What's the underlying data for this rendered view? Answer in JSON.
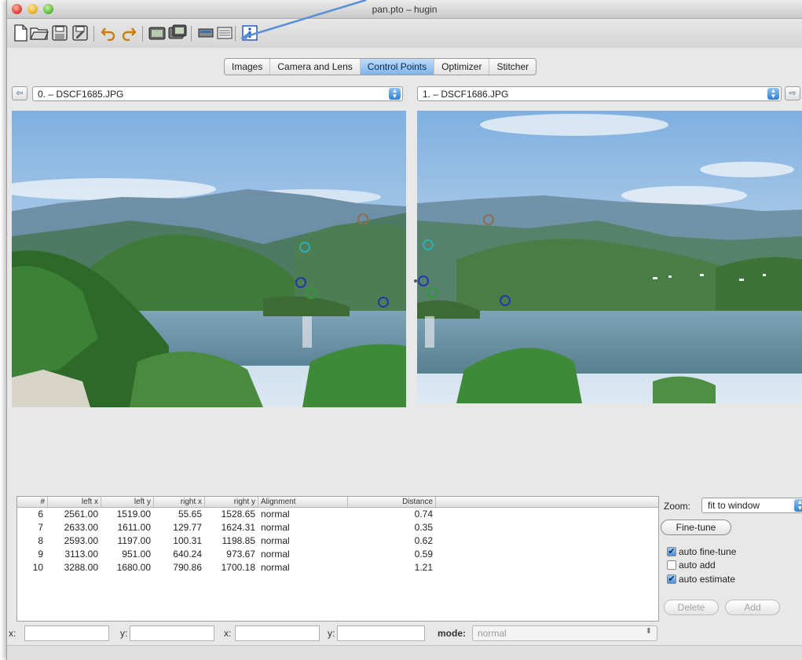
{
  "window": {
    "title": "pan.pto – hugin"
  },
  "toolbar": {
    "icons": [
      "new-file-icon",
      "open-folder-icon",
      "save-icon",
      "save-as-icon",
      "undo-icon",
      "redo-icon",
      "assistant-icon",
      "batch-icon",
      "preview-icon",
      "fast-preview-icon",
      "info-icon"
    ]
  },
  "tabs": [
    {
      "label": "Images"
    },
    {
      "label": "Camera and Lens"
    },
    {
      "label": "Control Points",
      "active": true
    },
    {
      "label": "Optimizer"
    },
    {
      "label": "Stitcher"
    }
  ],
  "left_image": {
    "selected": "0. – DSCF1685.JPG"
  },
  "right_image": {
    "selected": "1. – DSCF1686.JPG"
  },
  "control_points_colors": {
    "brown": "#8a6f57",
    "cyan": "#2bb0b8",
    "blue": "#1f3aa8",
    "green": "#2f9a3c"
  },
  "table": {
    "headers": [
      "#",
      "left x",
      "left y",
      "right x",
      "right y",
      "Alignment",
      "Distance"
    ],
    "rows": [
      [
        "6",
        "2561.00",
        "1519.00",
        "55.65",
        "1528.65",
        "normal",
        "0.74"
      ],
      [
        "7",
        "2633.00",
        "1611.00",
        "129.77",
        "1624.31",
        "normal",
        "0.35"
      ],
      [
        "8",
        "2593.00",
        "1197.00",
        "100.31",
        "1198.85",
        "normal",
        "0.62"
      ],
      [
        "9",
        "3113.00",
        "951.00",
        "640.24",
        "973.67",
        "normal",
        "0.59"
      ],
      [
        "10",
        "3288.00",
        "1680.00",
        "790.86",
        "1700.18",
        "normal",
        "1.21"
      ]
    ]
  },
  "bottom_fields": {
    "x1_label": "x:",
    "y1_label": "y:",
    "x2_label": "x:",
    "y2_label": "y:",
    "mode_label": "mode:",
    "mode_value": "normal"
  },
  "right_panel": {
    "zoom_label": "Zoom:",
    "zoom_value": "fit to window",
    "fine_tune": "Fine-tune",
    "auto_fine_tune": "auto fine-tune",
    "auto_add": "auto add",
    "auto_estimate": "auto estimate",
    "delete": "Delete",
    "add": "Add"
  }
}
